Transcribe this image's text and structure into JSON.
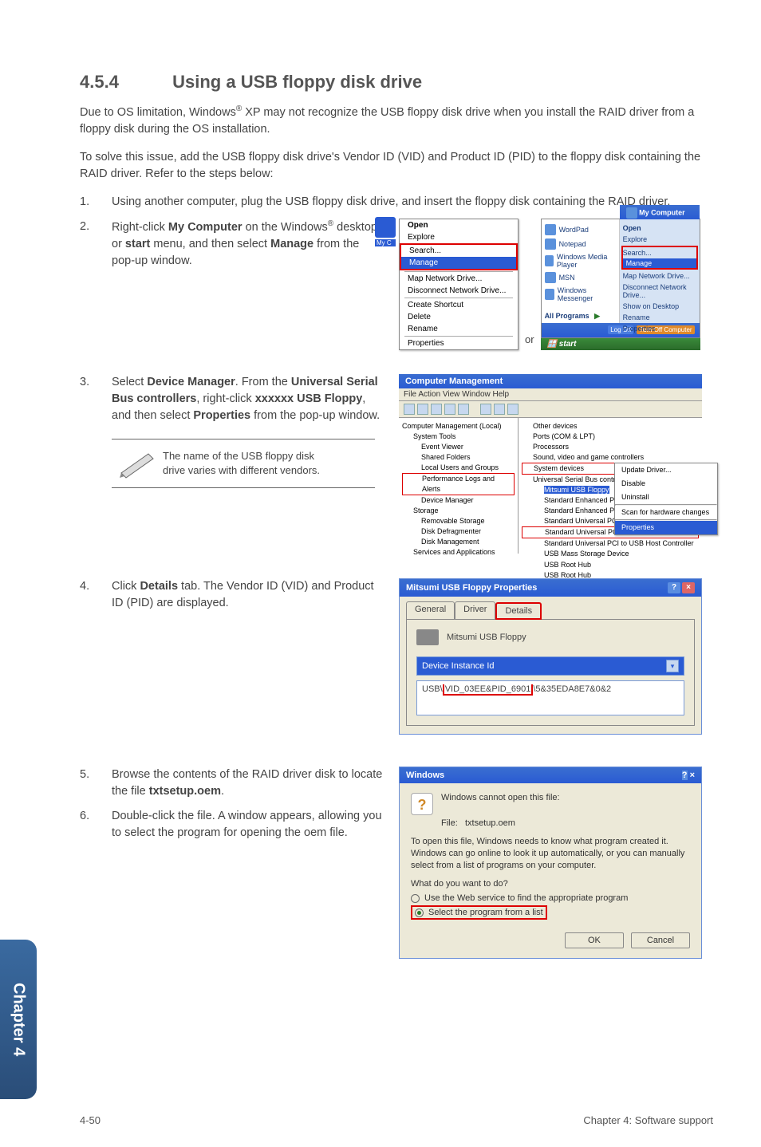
{
  "heading": {
    "num": "4.5.4",
    "title": "Using a USB floppy disk drive"
  },
  "intro1_a": "Due to OS limitation, Windows",
  "intro1_sup": "®",
  "intro1_b": " XP may not recognize the USB floppy disk drive when you install the RAID driver from a floppy disk during the OS installation.",
  "intro2": "To solve this issue, add the USB floppy disk drive's Vendor ID (VID) and Product ID (PID) to the floppy disk containing the RAID driver. Refer to the steps below:",
  "steps": {
    "s1": {
      "num": "1.",
      "text": "Using another computer, plug the USB floppy disk drive, and insert the floppy disk containing the RAID driver."
    },
    "s2": {
      "num": "2.",
      "a": "Right-click ",
      "b": "My Computer",
      "c": " on the Windows",
      "sup": "®",
      "d": " desktop or ",
      "e": "start",
      "f": " menu, and then select ",
      "g": "Manage",
      "h": " from the pop-up window."
    },
    "s3": {
      "num": "3.",
      "a": "Select ",
      "b": "Device Manager",
      "c": ". From the ",
      "d": "Universal Serial Bus controllers",
      "e": ", right-click ",
      "f": "xxxxxx USB Floppy",
      "g": ", and then select ",
      "h": "Properties",
      "i": " from the pop-up window."
    },
    "s4": {
      "num": "4.",
      "a": "Click ",
      "b": "Details",
      "c": " tab. The Vendor ID (VID) and Product ID (PID) are displayed."
    },
    "s5": {
      "num": "5.",
      "a": "Browse the contents of the RAID driver disk to locate the file ",
      "b": "txtsetup.oem",
      "c": "."
    },
    "s6": {
      "num": "6.",
      "text": "Double-click the file. A window appears, allowing you to select the program for opening the oem file."
    }
  },
  "note": "The name of the USB floppy disk disk drive varies with different vendors.",
  "note_line1": "The name of the USB floppy disk",
  "note_line2": "drive varies with different vendors.",
  "or_label": "or",
  "ss1": {
    "ctx": {
      "open": "Open",
      "explore": "Explore",
      "search": "Search...",
      "manage": "Manage",
      "map": "Map Network Drive...",
      "disc": "Disconnect Network Drive...",
      "shortcut": "Create Shortcut",
      "delete": "Delete",
      "rename": "Rename",
      "props": "Properties"
    },
    "icon_label": "My C",
    "sm": {
      "top": "My Computer",
      "wordpad": "WordPad",
      "notepad": "Notepad",
      "wmp": "Windows Media Player",
      "msn": "MSN",
      "messenger": "Windows Messenger",
      "allprog": "All Programs",
      "open": "Open",
      "explore": "Explore",
      "search": "Search...",
      "manage": "Manage",
      "map": "Map Network Drive...",
      "disc": "Disconnect Network Drive...",
      "show": "Show on Desktop",
      "rename": "Rename",
      "props": "Properties",
      "logoff": "Log Off",
      "turnoff": "Turn Off Computer",
      "start": "start"
    }
  },
  "ss2": {
    "title": "Computer Management",
    "menu": "File   Action   View   Window   Help",
    "left": {
      "root": "Computer Management (Local)",
      "systools": "System Tools",
      "ev": "Event Viewer",
      "sf": "Shared Folders",
      "lug": "Local Users and Groups",
      "perf": "Performance Logs and Alerts",
      "dm": "Device Manager",
      "storage": "Storage",
      "rs": "Removable Storage",
      "dd": "Disk Defragmenter",
      "dmg": "Disk Management",
      "sa": "Services and Applications"
    },
    "right": {
      "other": "Other devices",
      "ports": "Ports (COM & LPT)",
      "proc": "Processors",
      "svg": "Sound, video and game controllers",
      "sysdev": "System devices",
      "usb": "Universal Serial Bus controllers",
      "floppy": "Mitsumi USB Floppy",
      "senh": "Standard Enhanced PCI to USB Host Controller",
      "suni": "Standard Universal PCI to USB Host Controller",
      "mass": "USB Mass Storage Device",
      "root": "USB Root Hub"
    },
    "ctx": {
      "upd": "Update Driver...",
      "dis": "Disable",
      "uni": "Uninstall",
      "scan": "Scan for hardware changes",
      "props": "Properties"
    }
  },
  "ss3": {
    "title": "Mitsumi USB Floppy Properties",
    "help_btn": "?",
    "close_btn": "×",
    "tabs": {
      "general": "General",
      "driver": "Driver",
      "details": "Details"
    },
    "device": "Mitsumi USB Floppy",
    "combo": "Device Instance Id",
    "value_a": "USB\\",
    "value_b": "VID_03EE&PID_6901",
    "value_c": "\\5&35EDA8E7&0&2"
  },
  "ss4": {
    "title": "Windows",
    "help_btn": "?",
    "close_btn": "×",
    "cannot": "Windows cannot open this file:",
    "file_label": "File:",
    "file_name": "txtsetup.oem",
    "msg": "To open this file, Windows needs to know what program created it.  Windows can go online to look it up automatically, or you can manually select from a list of programs on your computer.",
    "q": "What do you want to do?",
    "opt1": "Use the Web service to find the appropriate program",
    "opt2": "Select the program from a list",
    "ok": "OK",
    "cancel": "Cancel"
  },
  "side_tab": "Chapter 4",
  "footer": {
    "left": "4-50",
    "right": "Chapter 4: Software support"
  }
}
